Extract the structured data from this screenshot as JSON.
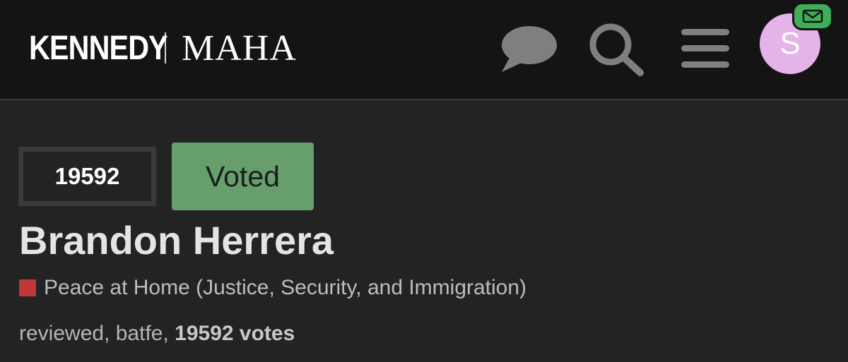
{
  "header": {
    "brand_primary": "KENNEDY",
    "brand_secondary": "MAHA",
    "avatar_letter": "S",
    "icons": [
      "chat-bubble-icon",
      "search-icon",
      "hamburger-menu-icon",
      "envelope-icon"
    ],
    "colors": {
      "bar_bg": "#141414",
      "icon_gray": "#7f7f7f",
      "avatar_bg": "#e3b3ea",
      "badge_green": "#3fae5a"
    }
  },
  "post": {
    "vote_count": "19592",
    "voted_label": "Voted",
    "title": "Brandon Herrera",
    "category": {
      "label": "Peace at Home (Justice, Security, and Immigration)",
      "color": "#c1383b"
    },
    "tags": [
      "reviewed",
      "batfe"
    ],
    "tag_separator": ", ",
    "votes_text": "19592 votes",
    "colors": {
      "voted_bg": "#669f6b",
      "count_border": "#3a3a3a"
    }
  }
}
